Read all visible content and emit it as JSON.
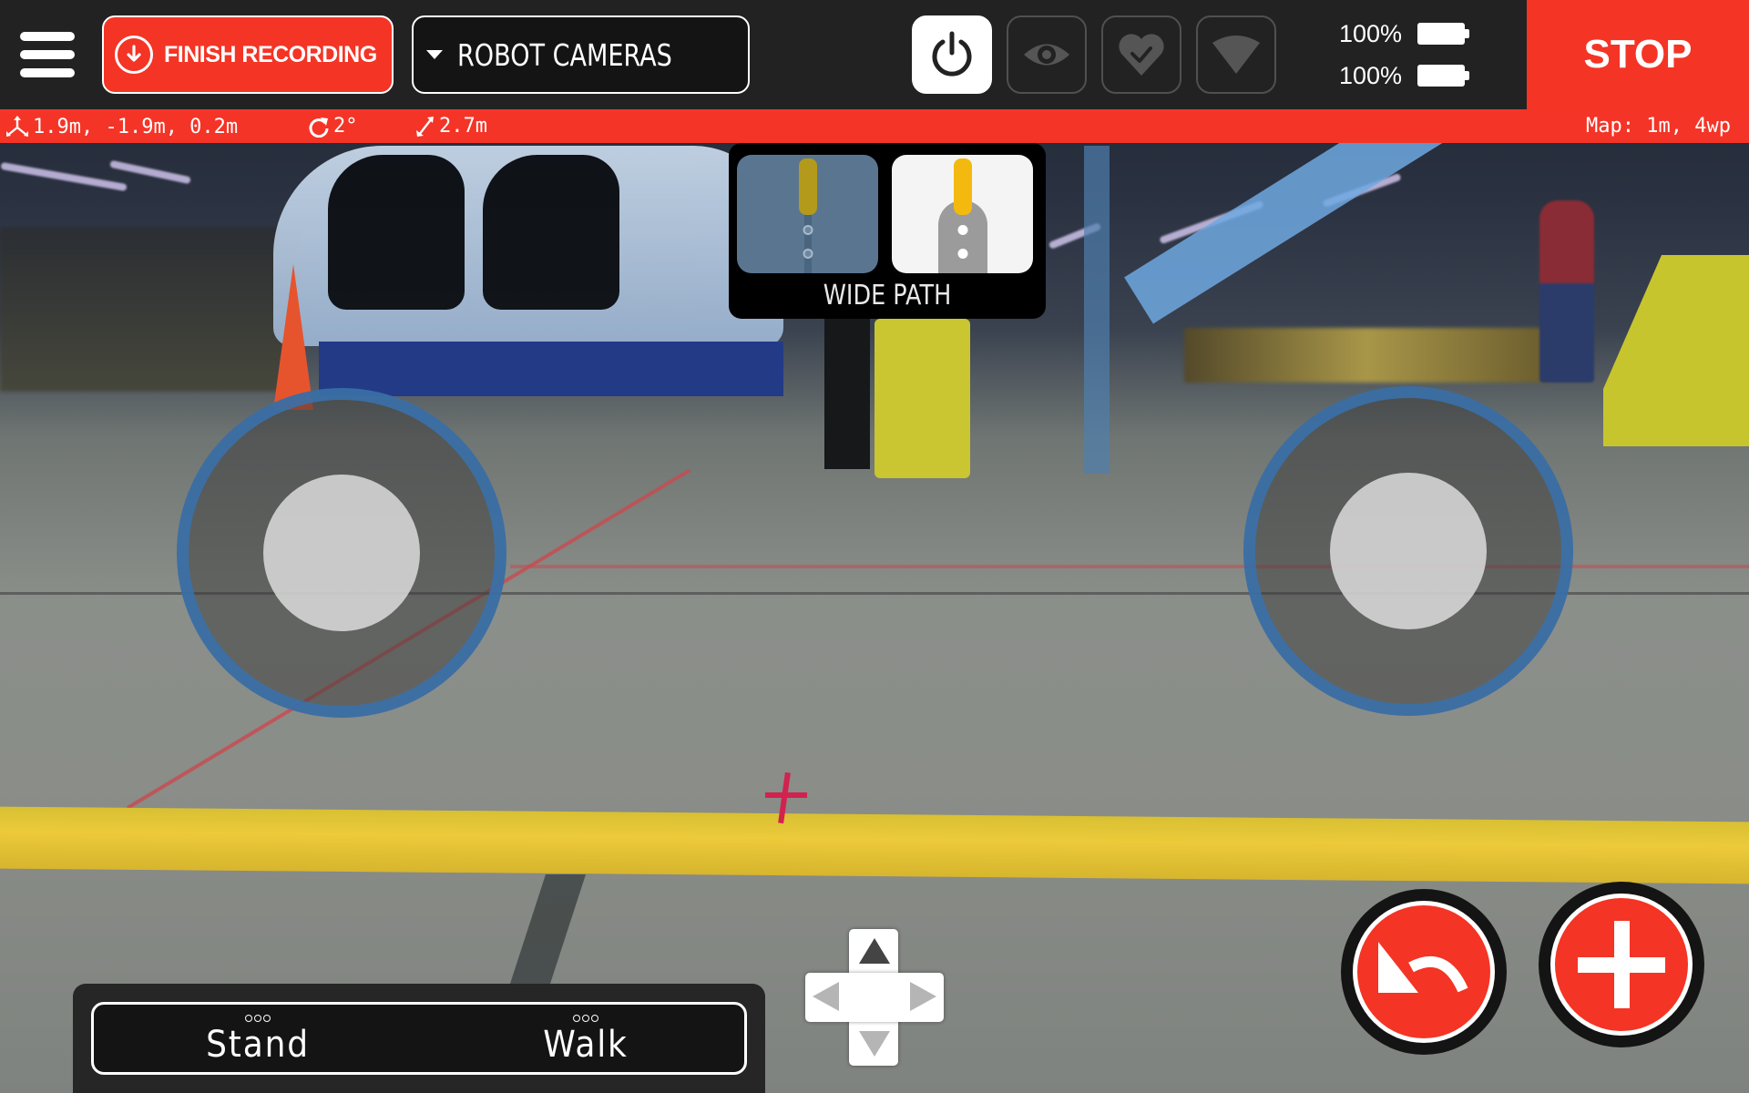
{
  "header": {
    "menu_icon": "hamburger-menu-icon",
    "finish_recording": {
      "label": "FINISH RECORDING",
      "icon": "download-circle-icon"
    },
    "camera_select": {
      "selected": "ROBOT CAMERAS",
      "icon": "caret-down-icon"
    },
    "status_buttons": [
      {
        "name": "power",
        "icon": "power-icon",
        "active": true
      },
      {
        "name": "visibility",
        "icon": "eye-icon",
        "active": false
      },
      {
        "name": "health",
        "icon": "heart-check-icon",
        "active": false
      },
      {
        "name": "signal",
        "icon": "wifi-signal-icon",
        "active": false
      }
    ],
    "batteries": [
      {
        "percent_label": "100%",
        "level": 1.0
      },
      {
        "percent_label": "100%",
        "level": 1.0
      }
    ],
    "stop_label": "STOP"
  },
  "status_bar": {
    "position": "1.9m, -1.9m, 0.2m",
    "rotation": "2°",
    "distance": "2.7m",
    "map": "Map: 1m, 4wp",
    "colors": {
      "background": "#f43427"
    }
  },
  "path_mode": {
    "label": "WIDE PATH",
    "options": [
      "narrow-path",
      "wide-path"
    ],
    "selected": "wide-path"
  },
  "mode_selector": {
    "options": [
      {
        "label": "Stand"
      },
      {
        "label": "Walk"
      }
    ]
  },
  "dpad": {
    "up": "up-arrow",
    "down": "down-arrow",
    "left": "left-arrow",
    "right": "right-arrow"
  },
  "actions": [
    {
      "name": "undo",
      "icon": "undo-arrow-icon"
    },
    {
      "name": "add-waypoint",
      "icon": "plus-icon"
    }
  ],
  "colors": {
    "accent_red": "#f43425",
    "header_bg": "#222222",
    "joystick_ring": "#3a6ea5"
  }
}
